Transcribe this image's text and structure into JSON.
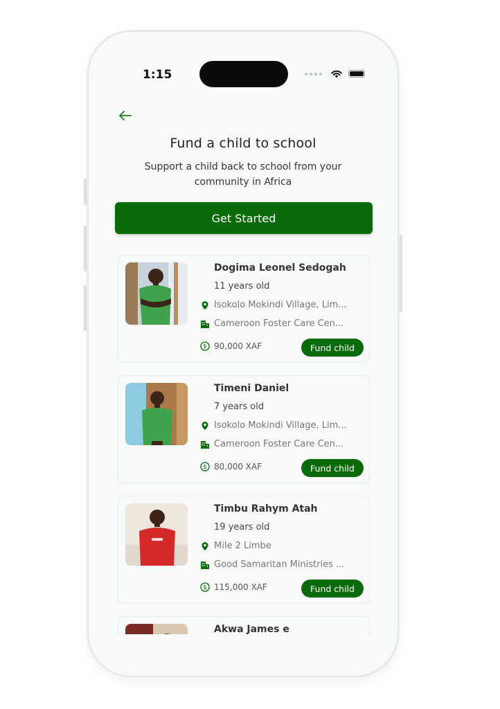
{
  "status_bar": {
    "time": "1:15"
  },
  "header": {
    "back_icon": "arrow-left-icon",
    "title": "Fund a child to school",
    "subtitle": "Support a child back to school from your community in Africa",
    "cta_label": "Get Started"
  },
  "colors": {
    "primary": "#0b6b0b",
    "background": "#f7faf9"
  },
  "children": [
    {
      "name": "Dogima Leonel Sedogah",
      "age": "11 years old",
      "location": "Isokolo Mokindi Village, Lim...",
      "organization": "Cameroon Foster Care Cen...",
      "amount": "90,000 XAF",
      "action": "Fund child"
    },
    {
      "name": "Timeni Daniel",
      "age": "7 years old",
      "location": "Isokolo Mokindi Village, Lim...",
      "organization": "Cameroon Foster Care Cen...",
      "amount": "80,000 XAF",
      "action": "Fund child"
    },
    {
      "name": "Timbu Rahym Atah",
      "age": "19 years old",
      "location": "Mile 2 Limbe",
      "organization": "Good Samaritan Ministries ...",
      "amount": "115,000 XAF",
      "action": "Fund child"
    },
    {
      "name": "Akwa James e"
    }
  ]
}
